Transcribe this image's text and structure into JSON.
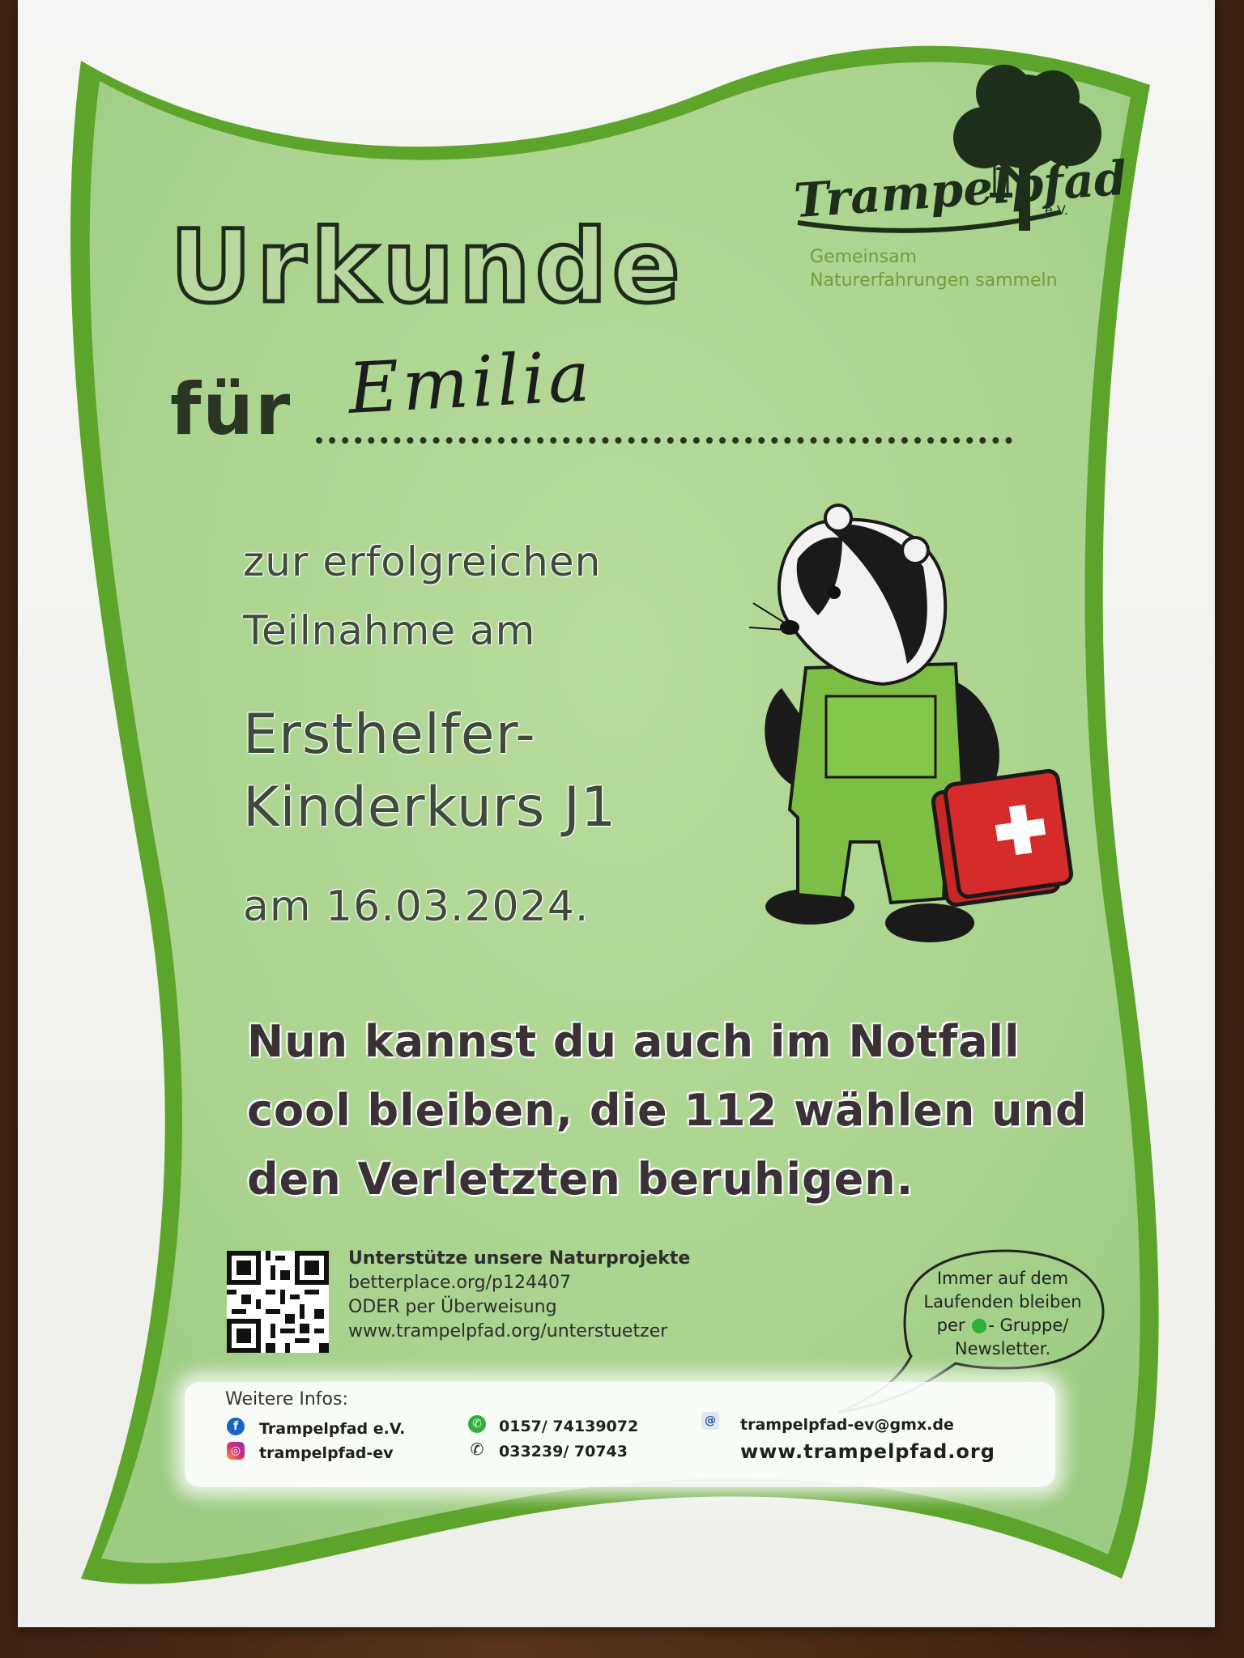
{
  "certificate": {
    "title": "Urkunde",
    "recipient_prefix": "für",
    "recipient_name": "Emilia",
    "intro_line1": "zur erfolgreichen",
    "intro_line2": "Teilnahme am",
    "course_line1": "Ersthelfer-",
    "course_line2": "Kinderkurs J1",
    "date_line": "am 16.03.2024.",
    "message_line1": "Nun kannst du auch im Notfall",
    "message_line2": "cool bleiben, die 112 wählen und",
    "message_line3": "den Verletzten beruhigen."
  },
  "logo": {
    "name": "Trampelpfad",
    "suffix": "e.V.",
    "tagline_line1": "Gemeinsam",
    "tagline_line2": "Naturerfahrungen sammeln",
    "overall_label": "Trampelpfad"
  },
  "support": {
    "heading": "Unterstütze unsere Naturprojekte",
    "line1": "betterplace.org/p124407",
    "line2": "ODER per Überweisung",
    "line3": "www.trampelpfad.org/unterstuetzer"
  },
  "bubble": {
    "line1": "Immer auf dem",
    "line2": "Laufenden bleiben",
    "line3_pre": "per",
    "line3_post": "- Gruppe/",
    "line4": "Newsletter."
  },
  "info": {
    "heading": "Weitere Infos:",
    "facebook": "Trampelpfad e.V.",
    "instagram": "trampelpfad-ev",
    "whatsapp": "0157/ 74139072",
    "phone": "033239/ 70743",
    "email": "trampelpfad-ev@gmx.de",
    "website": "www.trampelpfad.org"
  },
  "colors": {
    "background_green": "#a9d38e",
    "frame_green": "#5da42b",
    "first_aid_red": "#d62b2b"
  },
  "icons": {
    "facebook": "facebook-icon",
    "instagram": "instagram-icon",
    "whatsapp": "whatsapp-icon",
    "phone": "phone-icon",
    "email": "email-icon",
    "qr": "qr-code"
  }
}
